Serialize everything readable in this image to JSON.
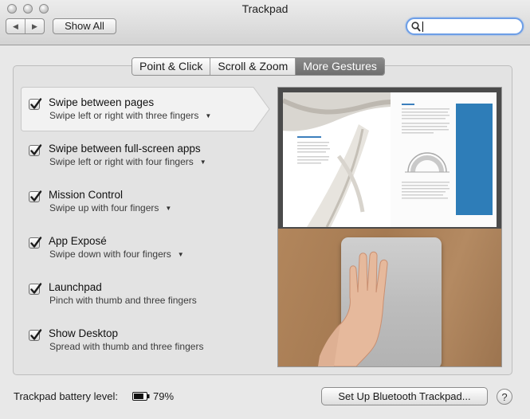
{
  "window": {
    "title": "Trackpad"
  },
  "toolbar": {
    "back_icon": "left-triangle",
    "forward_icon": "right-triangle",
    "show_all_label": "Show All",
    "search": {
      "value": "",
      "placeholder": ""
    }
  },
  "tabs": [
    {
      "label": "Point & Click",
      "active": false
    },
    {
      "label": "Scroll & Zoom",
      "active": false
    },
    {
      "label": "More Gestures",
      "active": true
    }
  ],
  "gestures": [
    {
      "title": "Swipe between pages",
      "subtitle": "Swipe left or right with three fingers",
      "checked": true,
      "has_dropdown": true,
      "selected": true
    },
    {
      "title": "Swipe between full-screen apps",
      "subtitle": "Swipe left or right with four fingers",
      "checked": true,
      "has_dropdown": true,
      "selected": false
    },
    {
      "title": "Mission Control",
      "subtitle": "Swipe up with four fingers",
      "checked": true,
      "has_dropdown": true,
      "selected": false
    },
    {
      "title": "App Exposé",
      "subtitle": "Swipe down with four fingers",
      "checked": true,
      "has_dropdown": true,
      "selected": false
    },
    {
      "title": "Launchpad",
      "subtitle": "Pinch with thumb and three fingers",
      "checked": true,
      "has_dropdown": false,
      "selected": false
    },
    {
      "title": "Show Desktop",
      "subtitle": "Spread with thumb and three fingers",
      "checked": true,
      "has_dropdown": false,
      "selected": false
    }
  ],
  "footer": {
    "battery_label": "Trackpad battery level:",
    "battery_value": "79%",
    "battery_fraction": 0.79,
    "setup_button": "Set Up Bluetooth Trackpad...",
    "help_label": "?"
  },
  "colors": {
    "accent": "#2a63c9",
    "search_focus": "#6d9ee6",
    "active_tab": "#7a7a7a",
    "book_sidebar": "#2e7db8"
  }
}
